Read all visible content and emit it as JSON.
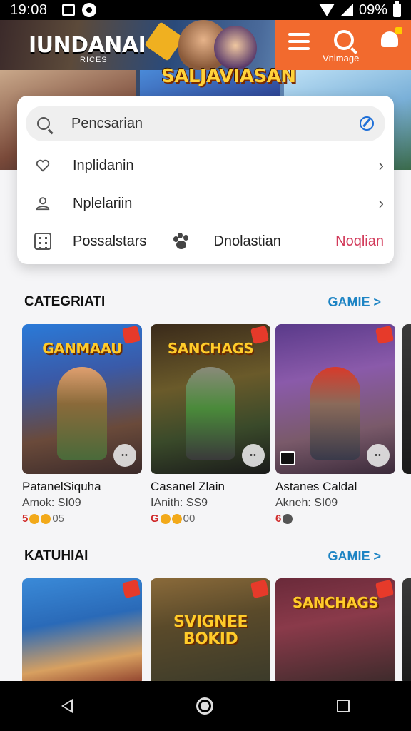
{
  "status_bar": {
    "time": "19:08",
    "battery": "09%"
  },
  "header": {
    "logo": "IUNDANAI",
    "logo_sub": "RICES",
    "banner_title": "SALJAVIASAN",
    "search_label": "Vnimage"
  },
  "menu": {
    "search": {
      "placeholder": "Pencsarian"
    },
    "items": [
      {
        "label": "Inplidanin",
        "icon": "heart-icon"
      },
      {
        "label": "Nplelariin",
        "icon": "user-icon"
      }
    ],
    "bottom_row": {
      "grid_label": "Possalstars",
      "paw_label": "Dnolastian",
      "accent_label": "Noqlian"
    }
  },
  "sections": [
    {
      "title": "CATEGRIATI",
      "more": "GAMIE >",
      "cards": [
        {
          "art_title": "GANMAAU",
          "name": "PatanelSiquha",
          "meta": "Amok: SI09",
          "num": "5",
          "count": "05"
        },
        {
          "art_title": "SANCHAGS",
          "name": "Casanel Zlain",
          "meta": "IAnith: SS9",
          "num": "G",
          "count": "00"
        },
        {
          "art_title": "",
          "name": "Astanes Caldal",
          "meta": "Akneh: SI09",
          "num": "6",
          "count": ""
        }
      ]
    },
    {
      "title": "KATUHIAI",
      "more": "GAMIE >",
      "cards": [
        {
          "art_title": ""
        },
        {
          "art_title": "SVIGNEE BOKID"
        },
        {
          "art_title": "SANCHAGS"
        }
      ]
    }
  ],
  "colors": {
    "accent_orange": "#f26a2e",
    "link_blue": "#1d84c4",
    "accent_red": "#d02a2a",
    "accent_pink": "#d23a5a"
  }
}
